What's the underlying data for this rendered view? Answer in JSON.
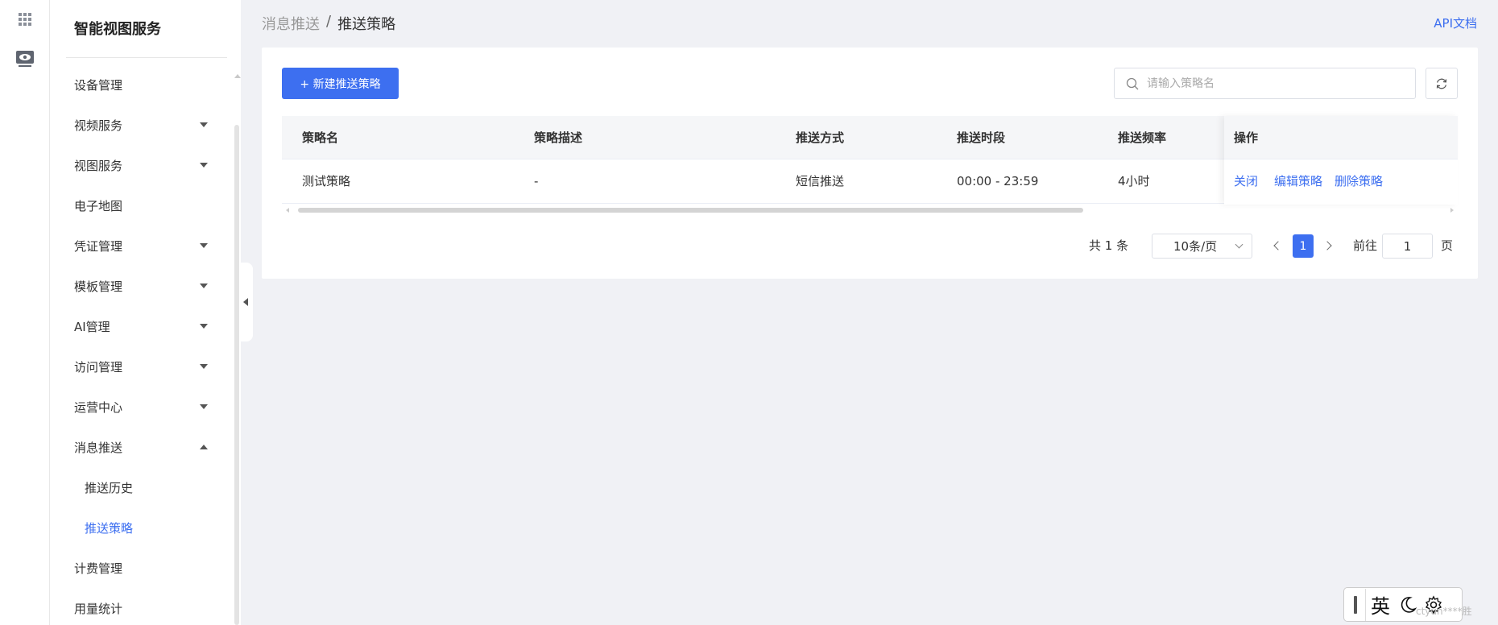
{
  "app": {
    "title": "智能视图服务"
  },
  "nav": {
    "items": [
      {
        "label": "设备管理",
        "caret": "none"
      },
      {
        "label": "视频服务",
        "caret": "down"
      },
      {
        "label": "视图服务",
        "caret": "down"
      },
      {
        "label": "电子地图",
        "caret": "none"
      },
      {
        "label": "凭证管理",
        "caret": "down"
      },
      {
        "label": "模板管理",
        "caret": "down"
      },
      {
        "label": "AI管理",
        "caret": "down"
      },
      {
        "label": "访问管理",
        "caret": "down"
      },
      {
        "label": "运营中心",
        "caret": "down"
      },
      {
        "label": "消息推送",
        "caret": "up"
      },
      {
        "label": "计费管理",
        "caret": "none"
      },
      {
        "label": "用量统计",
        "caret": "none"
      }
    ],
    "sub_items": [
      {
        "label": "推送历史",
        "active": false
      },
      {
        "label": "推送策略",
        "active": true
      }
    ]
  },
  "breadcrumb": {
    "parent": "消息推送",
    "separator": "/",
    "current": "推送策略"
  },
  "header": {
    "api_link": "API文档"
  },
  "toolbar": {
    "new_button": "+ 新建推送策略",
    "search_placeholder": "请输入策略名",
    "refresh_icon": "refresh-icon"
  },
  "table": {
    "columns": [
      "策略名",
      "策略描述",
      "推送方式",
      "推送时段",
      "推送频率",
      "操作"
    ],
    "rows": [
      {
        "name": "测试策略",
        "description": "-",
        "method": "短信推送",
        "period": "00:00 - 23:59",
        "frequency": "4小时",
        "actions": [
          "关闭",
          "编辑策略",
          "删除策略"
        ]
      }
    ]
  },
  "pagination": {
    "total_text": "共 1 条",
    "page_size": "10条/页",
    "current_page": "1",
    "goto_label": "前往",
    "goto_value": "1",
    "page_suffix": "页"
  },
  "ime": {
    "lang": "英"
  },
  "watermark": "ctyun****胜",
  "colors": {
    "accent": "#3d6ff0",
    "background": "#f0f1f5"
  }
}
